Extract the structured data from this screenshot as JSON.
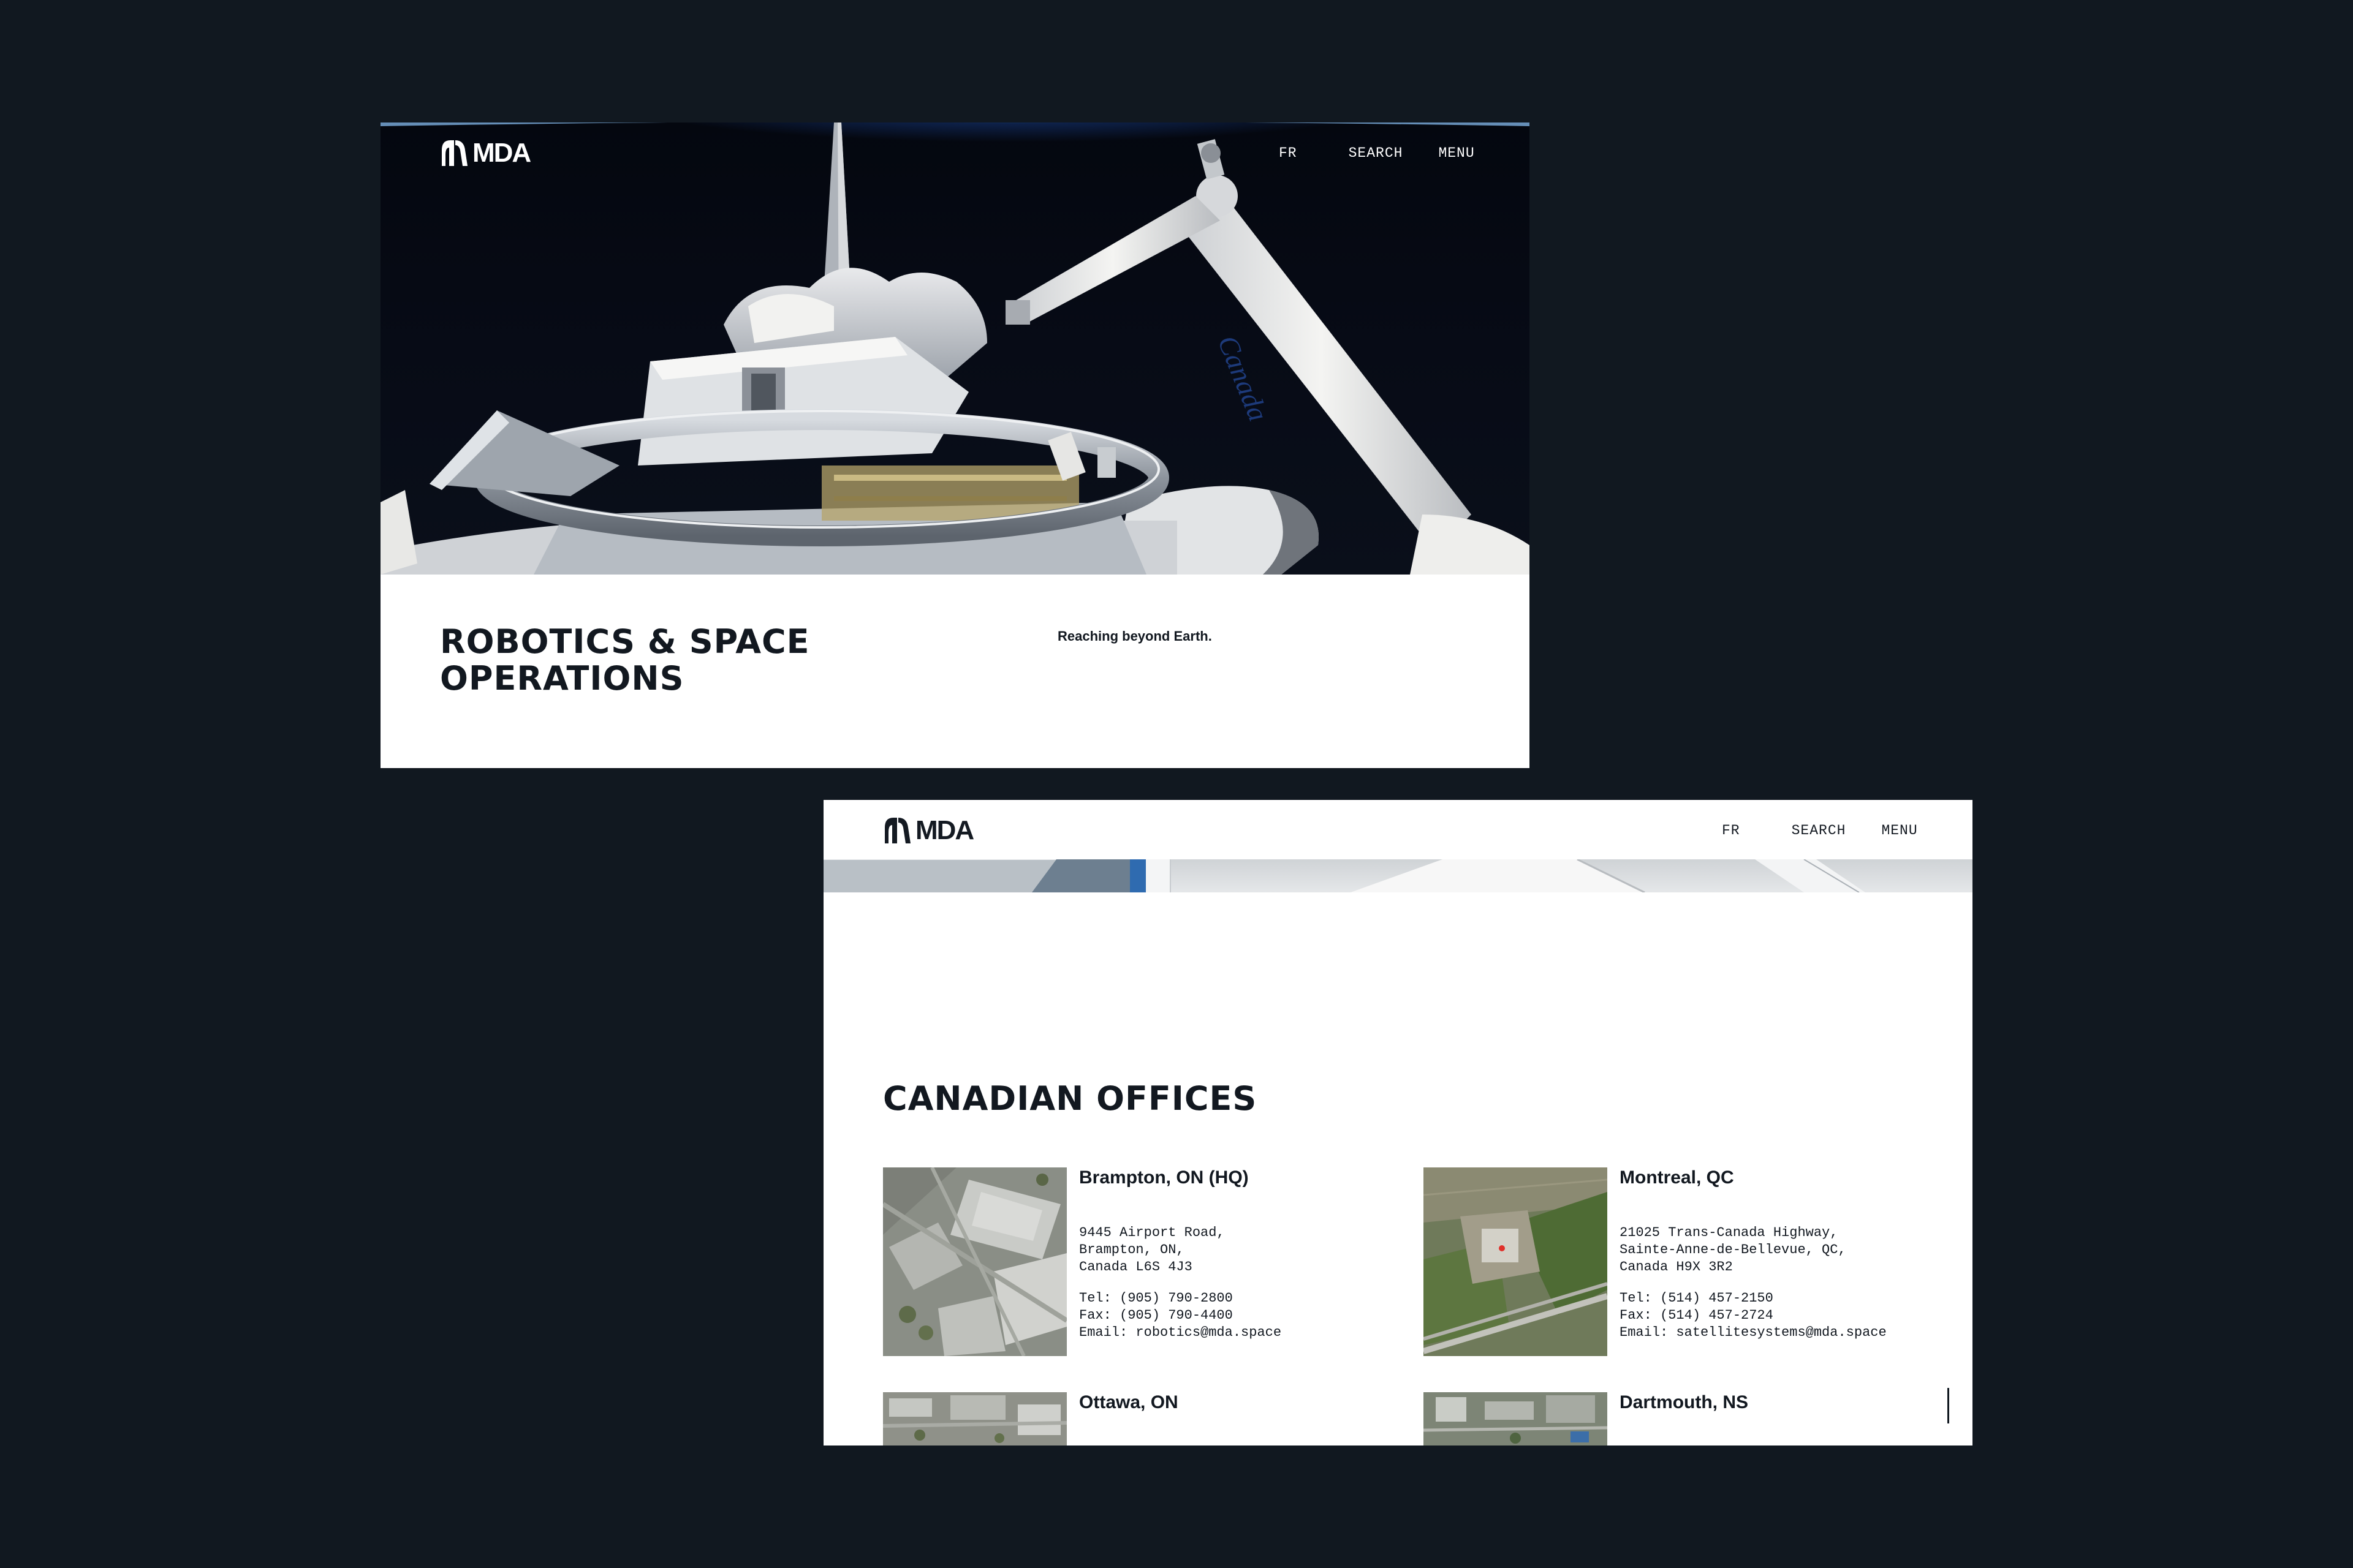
{
  "brand": {
    "name": "MDA"
  },
  "nav": {
    "lang": "FR",
    "search": "SEARCH",
    "menu": "MENU"
  },
  "hero": {
    "title_line1": "ROBOTICS & SPACE",
    "title_line2": "OPERATIONS",
    "subtitle": "Reaching beyond Earth.",
    "arm_label": "Canada"
  },
  "offices_page": {
    "title": "CANADIAN OFFICES",
    "offices": [
      {
        "name": "Brampton, ON (HQ)",
        "address": "9445 Airport Road,\nBrampton, ON,\nCanada L6S 4J3",
        "contact": "Tel: (905) 790-2800\nFax: (905) 790-4400\nEmail: robotics@mda.space"
      },
      {
        "name": "Montreal, QC",
        "address": "21025 Trans-Canada Highway,\nSainte-Anne-de-Bellevue, QC,\nCanada H9X 3R2",
        "contact": "Tel: (514) 457-2150\nFax: (514) 457-2724\nEmail: satellitesystems@mda.space"
      },
      {
        "name": "Ottawa, ON"
      },
      {
        "name": "Dartmouth, NS"
      }
    ]
  },
  "colors": {
    "page_bg": "#111820",
    "text_dark": "#121820",
    "panel_bg": "#ffffff"
  }
}
